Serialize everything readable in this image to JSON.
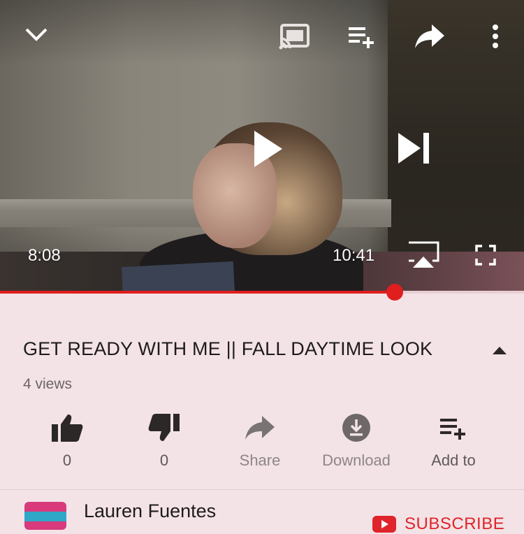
{
  "player": {
    "current_time": "8:08",
    "duration": "10:41",
    "progress": 0.753
  },
  "video": {
    "title": "GET READY WITH ME || FALL DAYTIME LOOK",
    "views": "4 views"
  },
  "actions": {
    "like_count": "0",
    "dislike_count": "0",
    "share_label": "Share",
    "download_label": "Download",
    "add_to_label": "Add to"
  },
  "channel": {
    "name": "Lauren Fuentes",
    "subscribe_label": "SUBSCRIBE"
  },
  "colors": {
    "accent": "#e01e1e",
    "background": "#f3e3e6"
  },
  "icons": [
    "chevron-down-icon",
    "cast-icon",
    "add-to-queue-icon",
    "share-icon",
    "more-vert-icon",
    "play-icon",
    "skip-next-icon",
    "airplay-icon",
    "fullscreen-icon",
    "thumbs-up-icon",
    "thumbs-down-icon",
    "download-icon",
    "playlist-add-icon",
    "collapse-icon",
    "youtube-icon"
  ]
}
